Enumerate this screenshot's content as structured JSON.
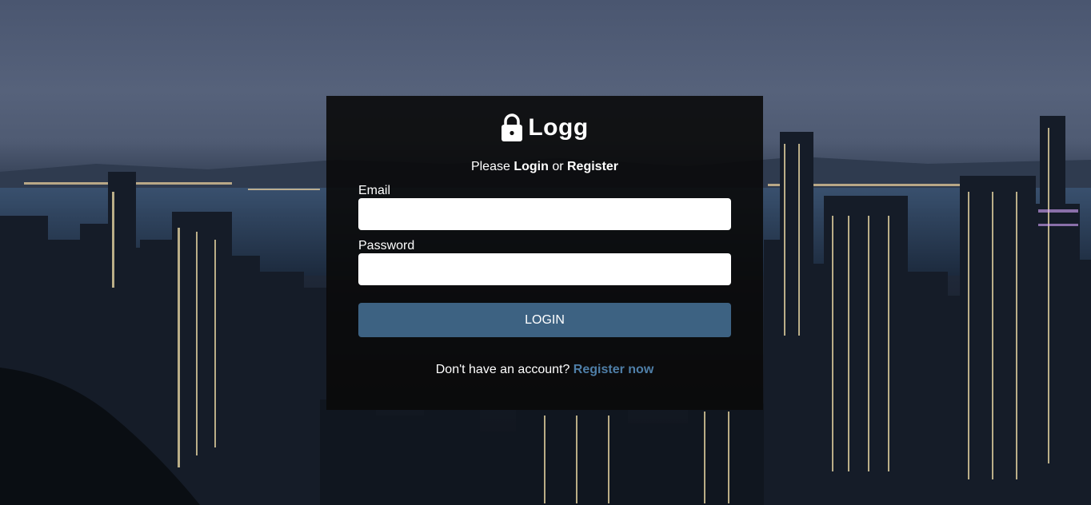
{
  "brand": {
    "title": "Logg",
    "icon": "lock-icon"
  },
  "subtitle": {
    "prefix": "Please ",
    "login": "Login",
    "middle": " or ",
    "register": "Register"
  },
  "form": {
    "email_label": "Email",
    "email_value": "",
    "password_label": "Password",
    "password_value": "",
    "submit_label": "LOGIN"
  },
  "footer": {
    "question": "Don't have an account? ",
    "link_label": "Register now"
  },
  "colors": {
    "button": "#3d6282",
    "link": "#4f7fa8",
    "card": "#0a0a0a"
  }
}
